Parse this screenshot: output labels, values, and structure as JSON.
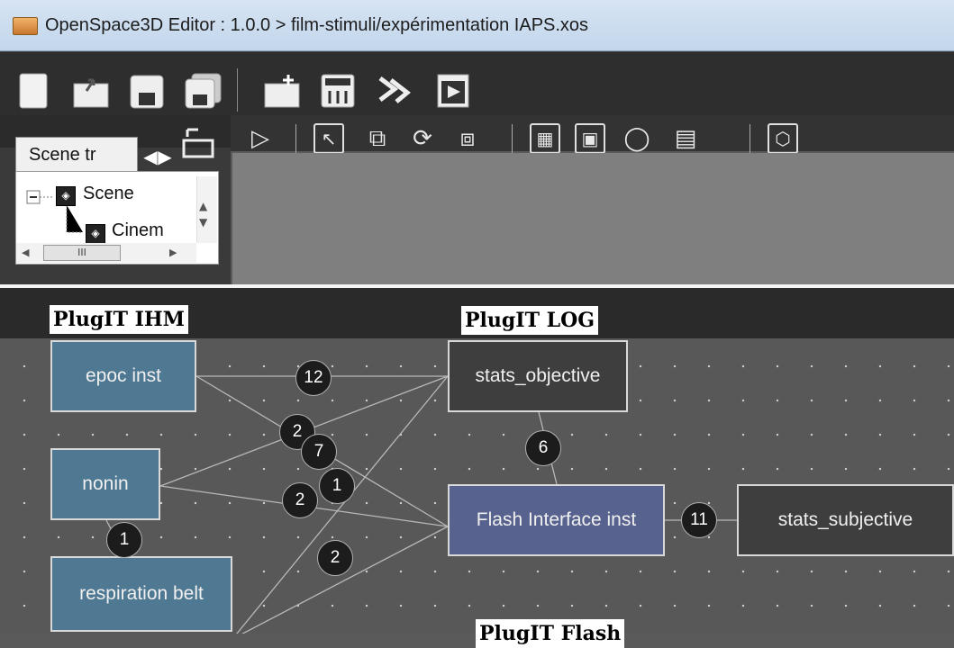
{
  "window": {
    "title": "OpenSpace3D Editor : 1.0.0 > film-stimuli/expérimentation IAPS.xos"
  },
  "scene_tree": {
    "tab_label": "Scene tr",
    "root_label": "Scene",
    "child_label": "Cinem",
    "hscroll_thumb": "III"
  },
  "graph": {
    "section_labels": {
      "ihm": "PlugIT IHM",
      "log": "PlugIT LOG",
      "flash": "PlugIT Flash"
    },
    "nodes": {
      "epoc": "epoc inst",
      "nonin": "nonin",
      "respiration": "respiration belt",
      "stats_objective": "stats_objective",
      "flash": "Flash Interface inst",
      "stats_subjective": "stats_subjective"
    },
    "badges": {
      "epoc_stats": "12",
      "b2_top": "2",
      "b7": "7",
      "b1_mid": "1",
      "b2_mid": "2",
      "b2_low": "2",
      "b6": "6",
      "b11": "11",
      "b1_left": "1"
    }
  },
  "colors": {
    "ihm_node": "#4f7892",
    "log_node": "#3e3e3e",
    "flash_node": "#58628e",
    "canvas_bg": "#585858"
  }
}
